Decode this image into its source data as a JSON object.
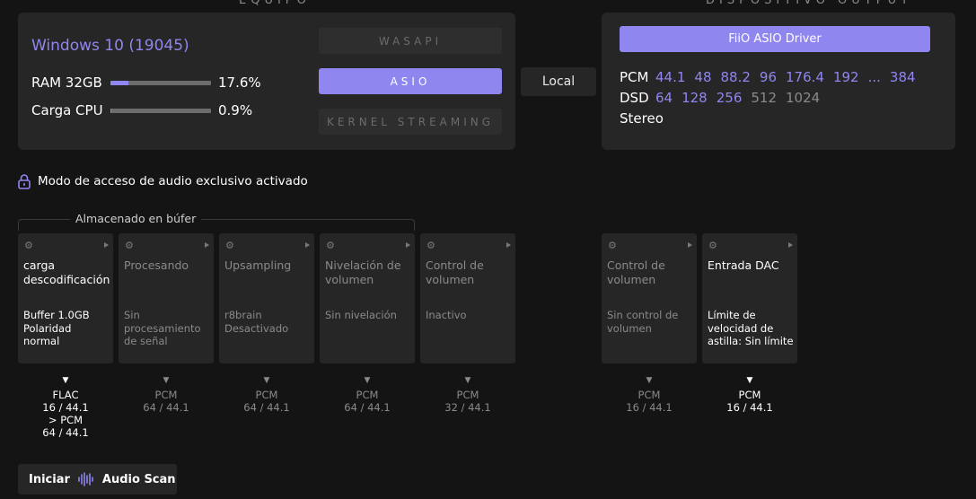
{
  "equipo": {
    "section_title": "EQUIPO",
    "os_title": "Windows 10 (19045)",
    "ram": {
      "label": "RAM 32GB",
      "value": "17.6%",
      "fraction": 0.176
    },
    "cpu": {
      "label": "Carga CPU",
      "value": "0.9%",
      "fraction": 0.009
    },
    "apis": [
      {
        "label": "WASAPI",
        "active": false
      },
      {
        "label": "ASIO",
        "active": true
      },
      {
        "label": "KERNEL STREAMING",
        "active": false
      }
    ],
    "local_button": "Local"
  },
  "output": {
    "section_title": "DISPOSITIVO OUTPUT",
    "driver": "FiiO ASIO Driver",
    "pcm_label": "PCM",
    "pcm_rates": [
      {
        "v": "44.1",
        "dim": false
      },
      {
        "v": "48",
        "dim": false
      },
      {
        "v": "88.2",
        "dim": false
      },
      {
        "v": "96",
        "dim": false
      },
      {
        "v": "176.4",
        "dim": false
      },
      {
        "v": "192",
        "dim": false
      },
      {
        "v": "...",
        "dim": false
      },
      {
        "v": "384",
        "dim": false
      }
    ],
    "dsd_label": "DSD",
    "dsd_rates": [
      {
        "v": "64",
        "dim": false
      },
      {
        "v": "128",
        "dim": false
      },
      {
        "v": "256",
        "dim": false
      },
      {
        "v": "512",
        "dim": true
      },
      {
        "v": "1024",
        "dim": true
      }
    ],
    "channels": "Stereo"
  },
  "exclusive_text": "Modo de acceso de audio exclusivo activado",
  "buffer_label": "Almacenado en búfer",
  "pipeline": [
    {
      "title": "carga descodificación",
      "desc": "Buffer 1.0GB Polaridad normal",
      "active": true,
      "fmt": [
        "FLAC",
        "16 / 44.1",
        "> PCM",
        "64 / 44.1"
      ]
    },
    {
      "title": "Procesando",
      "desc": "Sin procesamiento de señal",
      "active": false,
      "fmt": [
        "PCM",
        "64 / 44.1"
      ]
    },
    {
      "title": "Upsampling",
      "desc": "r8brain Desactivado",
      "active": false,
      "fmt": [
        "PCM",
        "64 / 44.1"
      ]
    },
    {
      "title": "Nivelación de volumen",
      "desc": "Sin nivelación",
      "active": false,
      "fmt": [
        "PCM",
        "64 / 44.1"
      ]
    },
    {
      "title": "Control de volumen",
      "desc": "Inactivo",
      "active": false,
      "fmt": [
        "PCM",
        "32 / 44.1"
      ]
    },
    {
      "title": "Control de volumen",
      "desc": "Sin control de volumen",
      "active": false,
      "fmt": [
        "PCM",
        "16 / 44.1"
      ]
    },
    {
      "title": "Entrada DAC",
      "desc": "Límite de velocidad de astilla: Sin límite",
      "active": true,
      "fmt": [
        "PCM",
        "16 / 44.1"
      ]
    }
  ],
  "scan": {
    "prefix": "Iniciar",
    "label": "Audio Scan"
  }
}
